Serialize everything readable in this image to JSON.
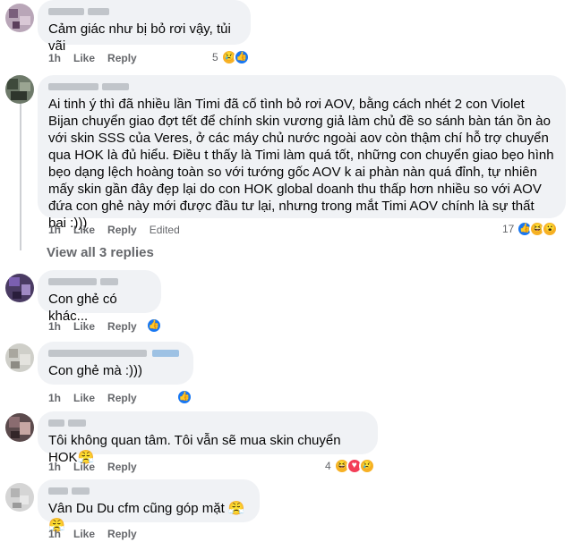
{
  "comments": [
    {
      "text": "Cảm giác như bị bỏ rơi vậy, tủi vãi",
      "actions": {
        "time": "1h",
        "like": "Like",
        "reply": "Reply"
      },
      "reactions": {
        "count": "5",
        "icons": [
          "sad-icon",
          "like-icon"
        ]
      }
    },
    {
      "text": "Ai tinh ý thì đã nhiều lần Timi đã cố tình bỏ rơi AOV, bằng cách nhét 2 con Violet Bijan chuyển giao đợt tết để chính skin vương giả làm chủ đề so sánh bàn tán ồn ào với skin SSS của Veres, ở các máy chủ nước ngoài aov còn thậm chí hỗ trợ chuyển qua HOK là đủ hiểu. Điều t thấy là Timi làm quá tốt, những con chuyển giao bẹo hình bẹo dạng lệch hoàng toàn so với tướng gốc AOV k ai phàn nàn quá đỉnh, tự nhiên mấy skin gần đây đẹp lại do con HOK global doanh thu thấp hơn nhiều so với AOV đứa con ghẻ này mới được đầu tư lại, nhưng trong mắt Timi AOV chính là sự thất bại :)))",
      "actions": {
        "time": "1h",
        "like": "Like",
        "reply": "Reply",
        "edited": "Edited"
      },
      "reactions": {
        "count": "17",
        "icons": [
          "like-icon",
          "haha-icon",
          "wow-icon"
        ]
      }
    },
    {
      "text": "Con ghẻ có khác...",
      "actions": {
        "time": "1h",
        "like": "Like",
        "reply": "Reply"
      },
      "reactions": {
        "count": "",
        "icons": [
          "like-icon"
        ]
      }
    },
    {
      "text": "Con ghẻ mà :)))",
      "actions": {
        "time": "1h",
        "like": "Like",
        "reply": "Reply"
      },
      "reactions": {
        "count": "",
        "icons": [
          "like-icon"
        ]
      }
    },
    {
      "text": "Tôi không quan tâm. Tôi vẫn sẽ mua skin chuyển HOK😤",
      "actions": {
        "time": "1h",
        "like": "Like",
        "reply": "Reply"
      },
      "reactions": {
        "count": "4",
        "icons": [
          "haha-icon",
          "love-icon",
          "sad-icon"
        ]
      }
    },
    {
      "text": "Vân Du Du cfm cũng góp mặt 😤😤",
      "actions": {
        "time": "1h",
        "like": "Like",
        "reply": "Reply"
      },
      "reactions": {
        "count": "",
        "icons": []
      }
    }
  ],
  "view_all_replies": "View all 3 replies",
  "colors": {
    "bubble": "#f0f2f5",
    "meta": "#65676b",
    "like_blue": "#1877f2",
    "thread_line": "#ced0d4"
  }
}
